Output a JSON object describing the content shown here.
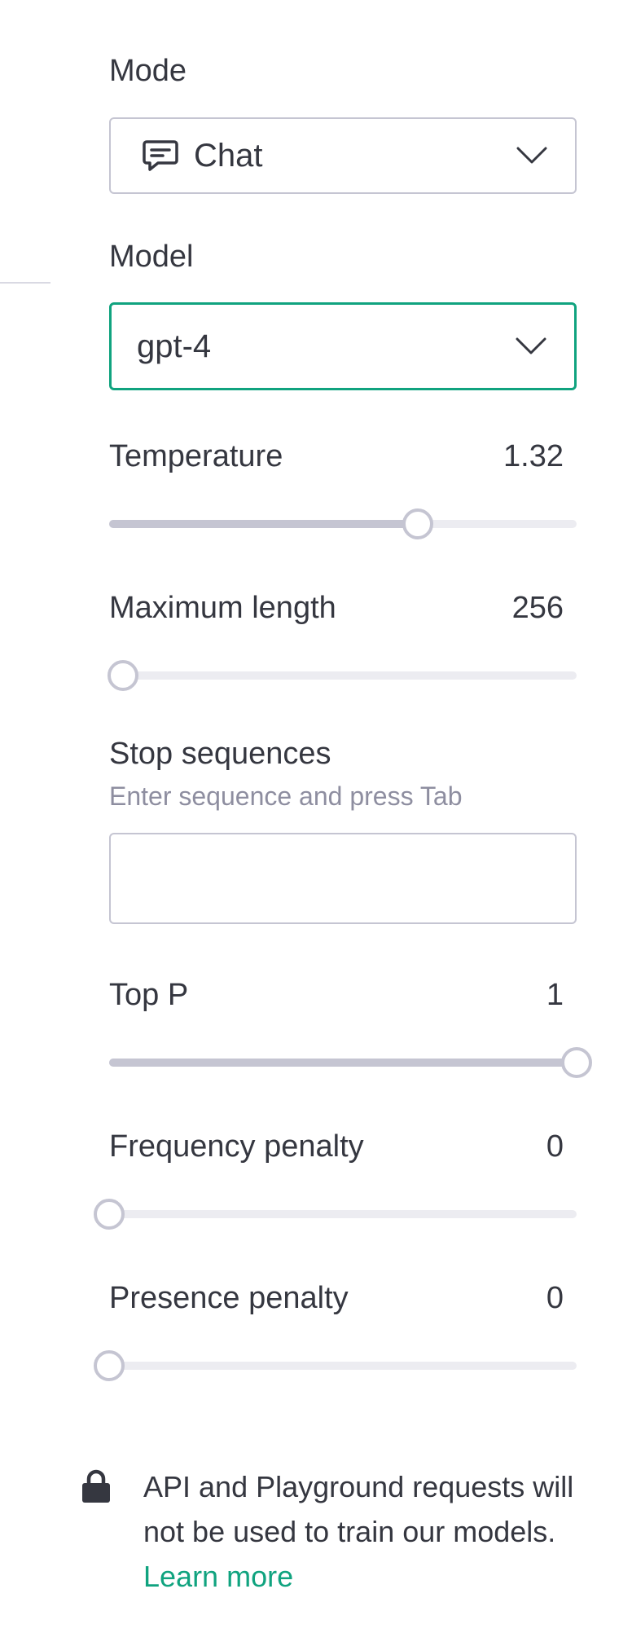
{
  "mode": {
    "label": "Mode",
    "selected": "Chat"
  },
  "model": {
    "label": "Model",
    "selected": "gpt-4"
  },
  "temperature": {
    "label": "Temperature",
    "value": "1.32",
    "fraction": 0.66
  },
  "maximum_length": {
    "label": "Maximum length",
    "value": "256",
    "fraction": 0.03
  },
  "stop_sequences": {
    "label": "Stop sequences",
    "hint": "Enter sequence and press Tab",
    "input_value": ""
  },
  "top_p": {
    "label": "Top P",
    "value": "1",
    "fraction": 1.0
  },
  "frequency_penalty": {
    "label": "Frequency penalty",
    "value": "0",
    "fraction": 0.0
  },
  "presence_penalty": {
    "label": "Presence penalty",
    "value": "0",
    "fraction": 0.0
  },
  "footer": {
    "text": "API and Playground requests will not be used to train our models.",
    "link_label": "Learn more"
  },
  "colors": {
    "accent": "#10a37f",
    "text": "#353740",
    "muted": "#8e8ea0",
    "border": "#c5c5d2",
    "track": "#ececf1"
  },
  "icons": {
    "mode": "chat-bubble-icon",
    "select": "chevron-down-icon",
    "footer": "lock-icon"
  }
}
